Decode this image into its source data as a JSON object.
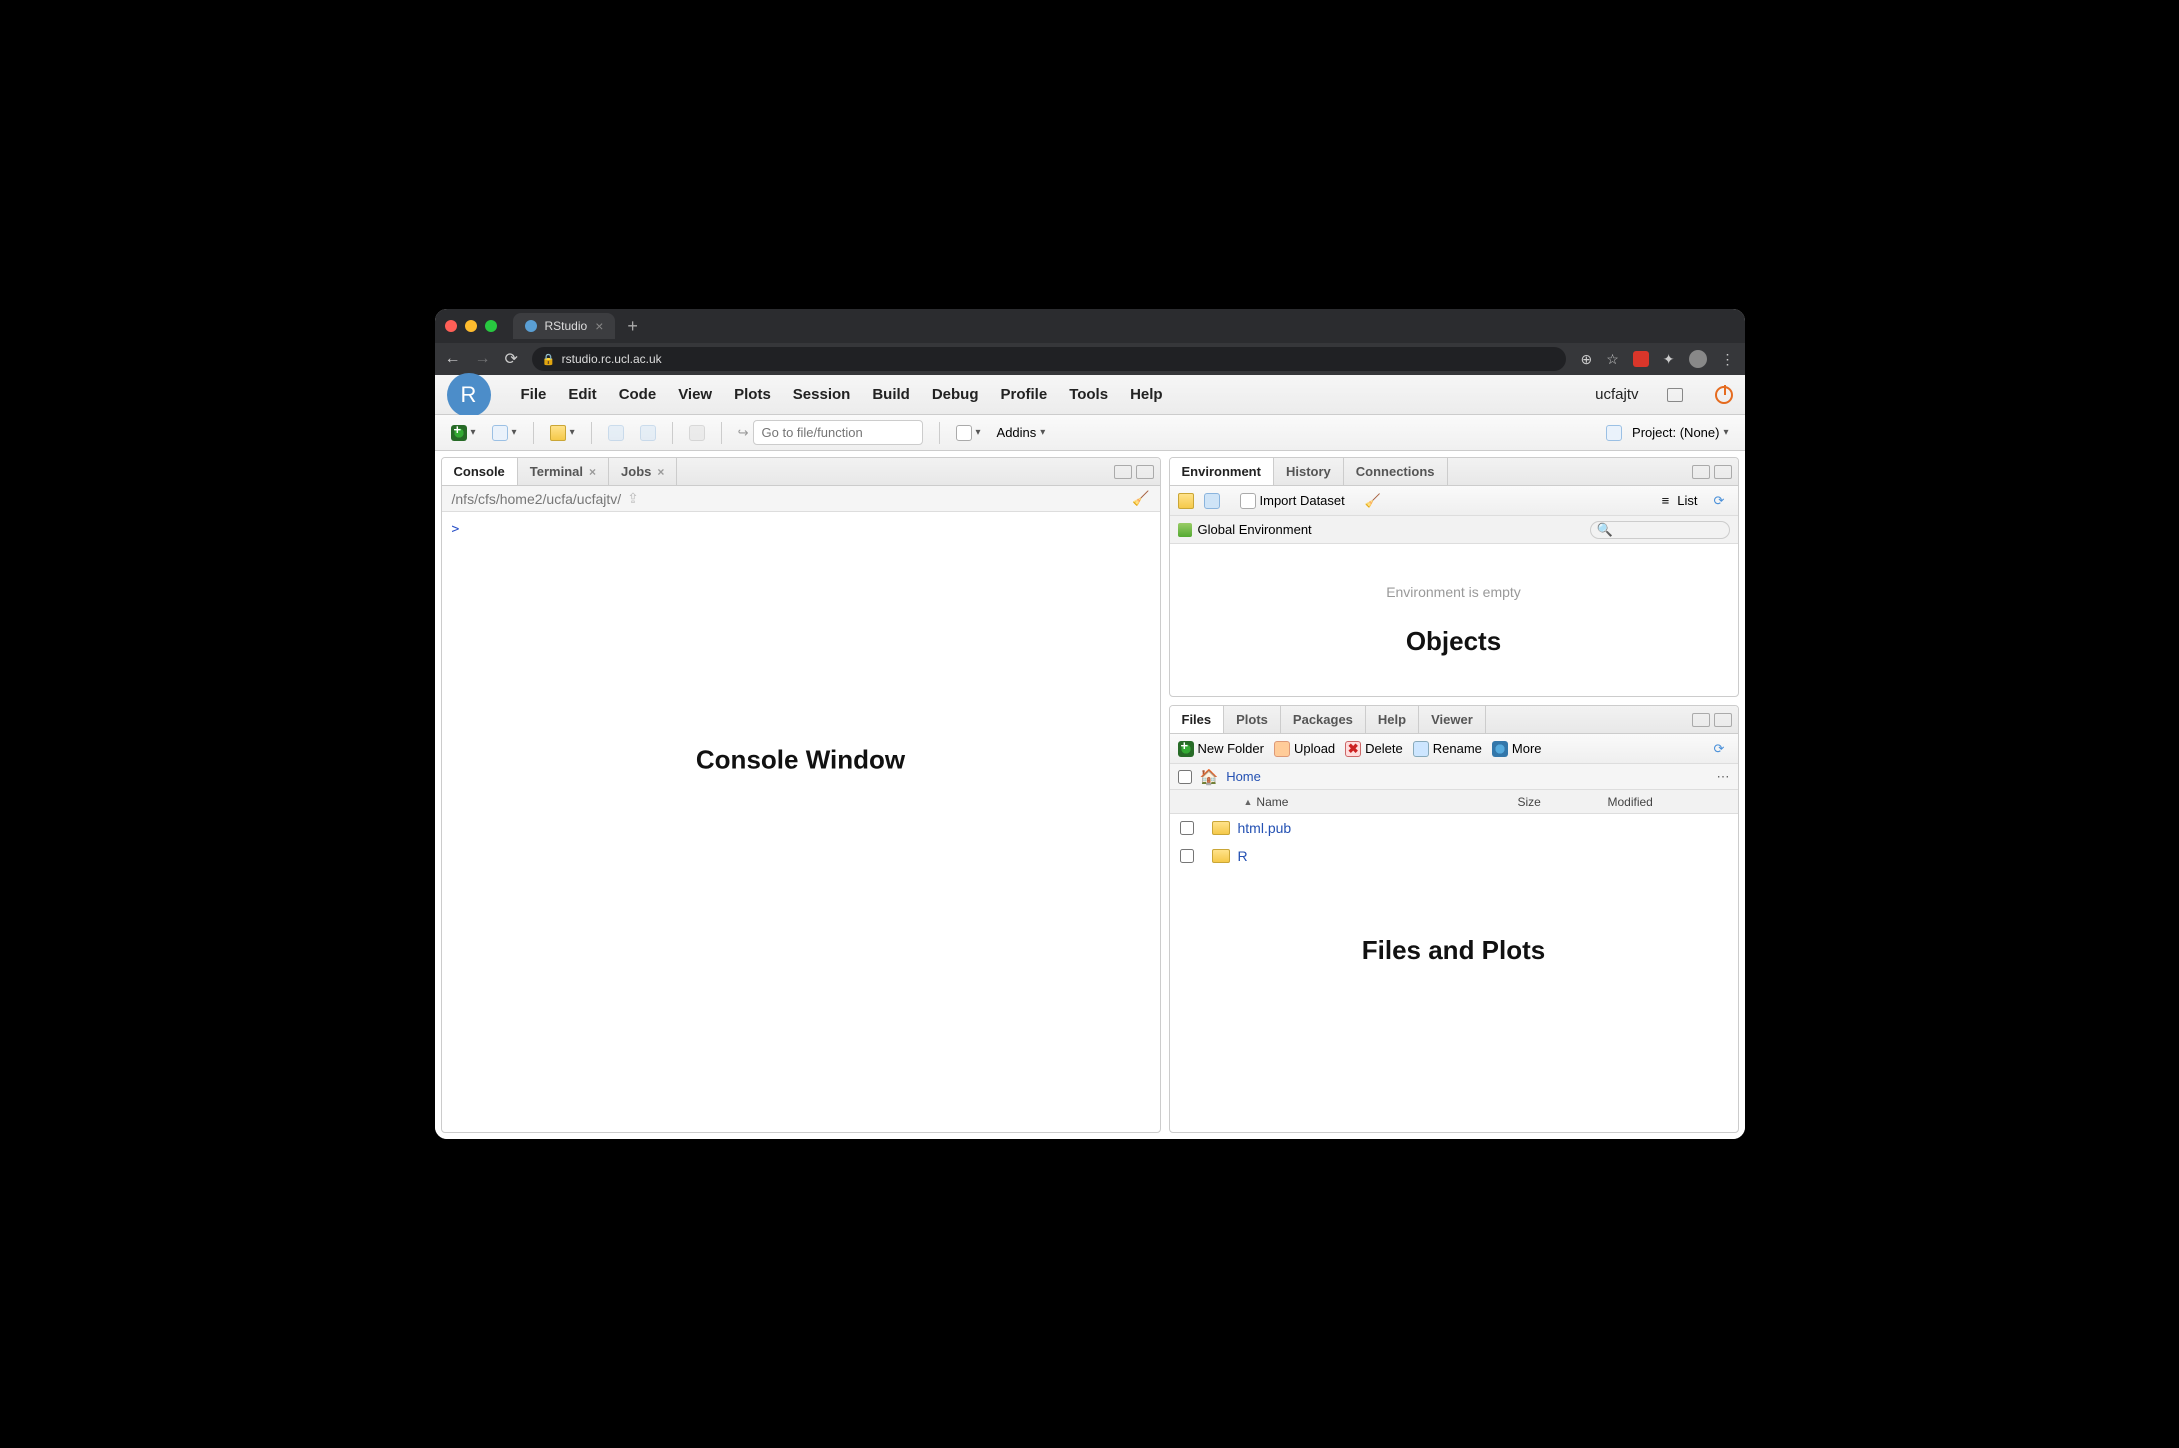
{
  "browser": {
    "tab_title": "RStudio",
    "url": "rstudio.rc.ucl.ac.uk"
  },
  "menubar": {
    "items": [
      "File",
      "Edit",
      "Code",
      "View",
      "Plots",
      "Session",
      "Build",
      "Debug",
      "Profile",
      "Tools",
      "Help"
    ],
    "user": "ucfajtv"
  },
  "toolbar": {
    "goto_placeholder": "Go to file/function",
    "addins": "Addins",
    "project": "Project: (None)"
  },
  "left": {
    "tabs": [
      "Console",
      "Terminal",
      "Jobs"
    ],
    "path": "/nfs/cfs/home2/ucfa/ucfajtv/",
    "prompt": ">",
    "overlay": "Console Window"
  },
  "env": {
    "tabs": [
      "Environment",
      "History",
      "Connections"
    ],
    "import": "Import Dataset",
    "list": "List",
    "scope": "Global Environment",
    "empty": "Environment is empty",
    "overlay": "Objects"
  },
  "files": {
    "tabs": [
      "Files",
      "Plots",
      "Packages",
      "Help",
      "Viewer"
    ],
    "btn_newfolder": "New Folder",
    "btn_upload": "Upload",
    "btn_delete": "Delete",
    "btn_rename": "Rename",
    "btn_more": "More",
    "breadcrumb_home": "Home",
    "col_name": "Name",
    "col_size": "Size",
    "col_modified": "Modified",
    "rows": [
      {
        "name": "html.pub"
      },
      {
        "name": "R"
      }
    ],
    "overlay": "Files and Plots"
  }
}
